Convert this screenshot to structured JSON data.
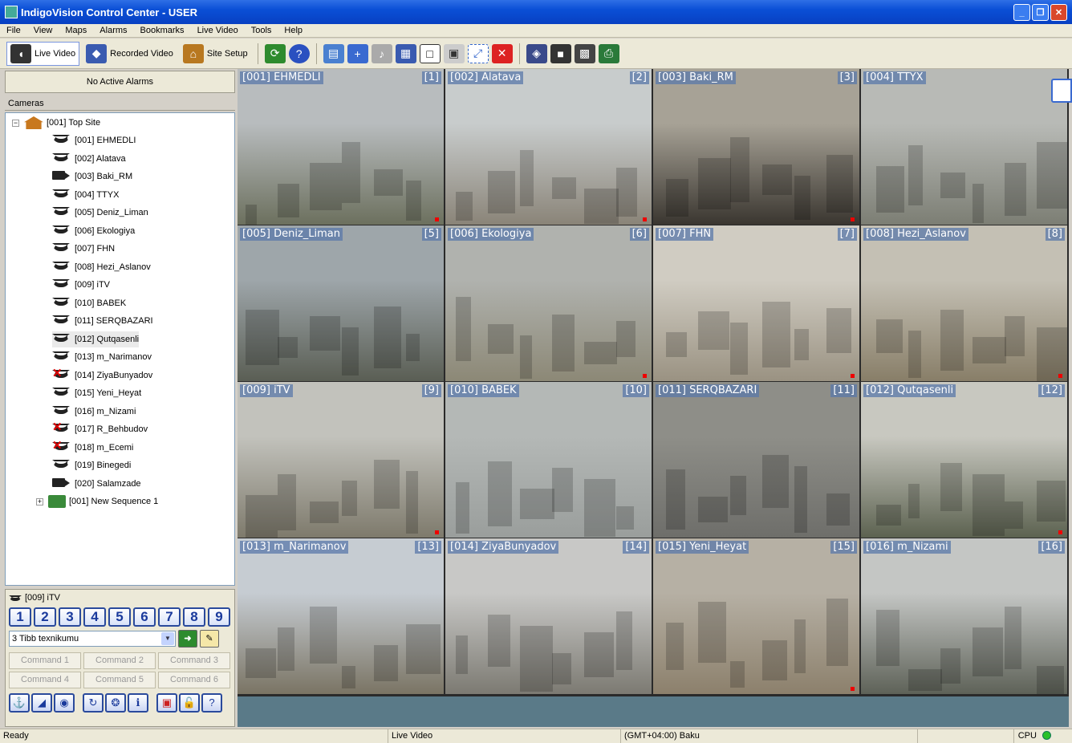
{
  "window": {
    "title": "IndigoVision Control Center - USER"
  },
  "menu": [
    "File",
    "View",
    "Maps",
    "Alarms",
    "Bookmarks",
    "Live Video",
    "Tools",
    "Help"
  ],
  "toolbar": {
    "live_video": "Live Video",
    "recorded_video": "Recorded Video",
    "site_setup": "Site Setup"
  },
  "alarms": {
    "text": "No Active Alarms"
  },
  "cameras": {
    "header": "Cameras",
    "site": "[001] Top Site",
    "items": [
      {
        "label": "[001] EHMEDLI",
        "type": "dome",
        "fault": false
      },
      {
        "label": "[002] Alatava",
        "type": "dome",
        "fault": false
      },
      {
        "label": "[003] Baki_RM",
        "type": "box",
        "fault": false
      },
      {
        "label": "[004] TTYX",
        "type": "dome",
        "fault": false
      },
      {
        "label": "[005] Deniz_Liman",
        "type": "dome",
        "fault": false
      },
      {
        "label": "[006] Ekologiya",
        "type": "dome",
        "fault": false
      },
      {
        "label": "[007] FHN",
        "type": "dome",
        "fault": false
      },
      {
        "label": "[008] Hezi_Aslanov",
        "type": "dome",
        "fault": false
      },
      {
        "label": "[009] iTV",
        "type": "dome",
        "fault": false
      },
      {
        "label": "[010] BABEK",
        "type": "dome",
        "fault": false
      },
      {
        "label": "[011] SERQBAZARI",
        "type": "dome",
        "fault": false
      },
      {
        "label": "[012] Qutqasenli",
        "type": "dome",
        "fault": false,
        "selected": true
      },
      {
        "label": "[013] m_Narimanov",
        "type": "dome",
        "fault": false
      },
      {
        "label": "[014] ZiyaBunyadov",
        "type": "dome",
        "fault": true
      },
      {
        "label": "[015] Yeni_Heyat",
        "type": "dome",
        "fault": false
      },
      {
        "label": "[016] m_Nizami",
        "type": "dome",
        "fault": false
      },
      {
        "label": "[017] R_Behbudov",
        "type": "dome",
        "fault": true
      },
      {
        "label": "[018] m_Ecemi",
        "type": "dome",
        "fault": true
      },
      {
        "label": "[019] Binegedi",
        "type": "dome",
        "fault": false
      },
      {
        "label": "[020] Salamzade",
        "type": "box",
        "fault": false
      }
    ],
    "sequence": "[001] New Sequence 1"
  },
  "ptz": {
    "camera": "[009] iTV",
    "numbers": [
      "1",
      "2",
      "3",
      "4",
      "5",
      "6",
      "7",
      "8",
      "9"
    ],
    "preset": "3 Tibb texnikumu",
    "commands": [
      "Command 1",
      "Command 2",
      "Command 3",
      "Command 4",
      "Command 5",
      "Command 6"
    ]
  },
  "tiles": [
    {
      "name": "[001] EHMEDLI",
      "index": "[1]",
      "rec": true,
      "sky": "#b8bcbe",
      "ground": "#6c705e"
    },
    {
      "name": "[002] Alatava",
      "index": "[2]",
      "rec": true,
      "sky": "#c8cccc",
      "ground": "#8a8478"
    },
    {
      "name": "[003] Baki_RM",
      "index": "[3]",
      "rec": true,
      "sky": "#a7a296",
      "ground": "#3a3630"
    },
    {
      "name": "[004] TTYX",
      "index": "",
      "rec": false,
      "sky": "#b8bab6",
      "ground": "#7c7e74"
    },
    {
      "name": "[005] Deniz_Liman",
      "index": "[5]",
      "rec": false,
      "sky": "#9ea6aa",
      "ground": "#5a5e54"
    },
    {
      "name": "[006] Ekologiya",
      "index": "[6]",
      "rec": true,
      "sky": "#b0b2ae",
      "ground": "#8c8876"
    },
    {
      "name": "[007] FHN",
      "index": "[7]",
      "rec": true,
      "sky": "#d0ccc2",
      "ground": "#9a9282"
    },
    {
      "name": "[008] Hezi_Aslanov",
      "index": "[8]",
      "rec": true,
      "sky": "#c4c0b4",
      "ground": "#887e68"
    },
    {
      "name": "[009] iTV",
      "index": "[9]",
      "rec": true,
      "sky": "#c2c2bc",
      "ground": "#7e7a6c"
    },
    {
      "name": "[010] BABEK",
      "index": "[10]",
      "rec": false,
      "sky": "#b4b8b6",
      "ground": "#9a9e9c"
    },
    {
      "name": "[011] SERQBAZARI",
      "index": "[11]",
      "rec": false,
      "sky": "#8e8e88",
      "ground": "#6e6e6a"
    },
    {
      "name": "[012] Qutqasenli",
      "index": "[12]",
      "rec": true,
      "sky": "#c8c8c0",
      "ground": "#5c6250"
    },
    {
      "name": "[013] m_Narimanov",
      "index": "[13]",
      "rec": false,
      "sky": "#c6ccd2",
      "ground": "#7a7464"
    },
    {
      "name": "[014] ZiyaBunyadov",
      "index": "[14]",
      "rec": false,
      "sky": "#c8c8c6",
      "ground": "#7c7a72"
    },
    {
      "name": "[015] Yeni_Heyat",
      "index": "[15]",
      "rec": true,
      "sky": "#b6b0a4",
      "ground": "#8c806c"
    },
    {
      "name": "[016] m_Nizami",
      "index": "[16]",
      "rec": false,
      "sky": "#c4c6c4",
      "ground": "#5e6258"
    }
  ],
  "status": {
    "ready": "Ready",
    "mode": "Live Video",
    "timezone": "(GMT+04:00) Baku",
    "cpu": "CPU"
  }
}
